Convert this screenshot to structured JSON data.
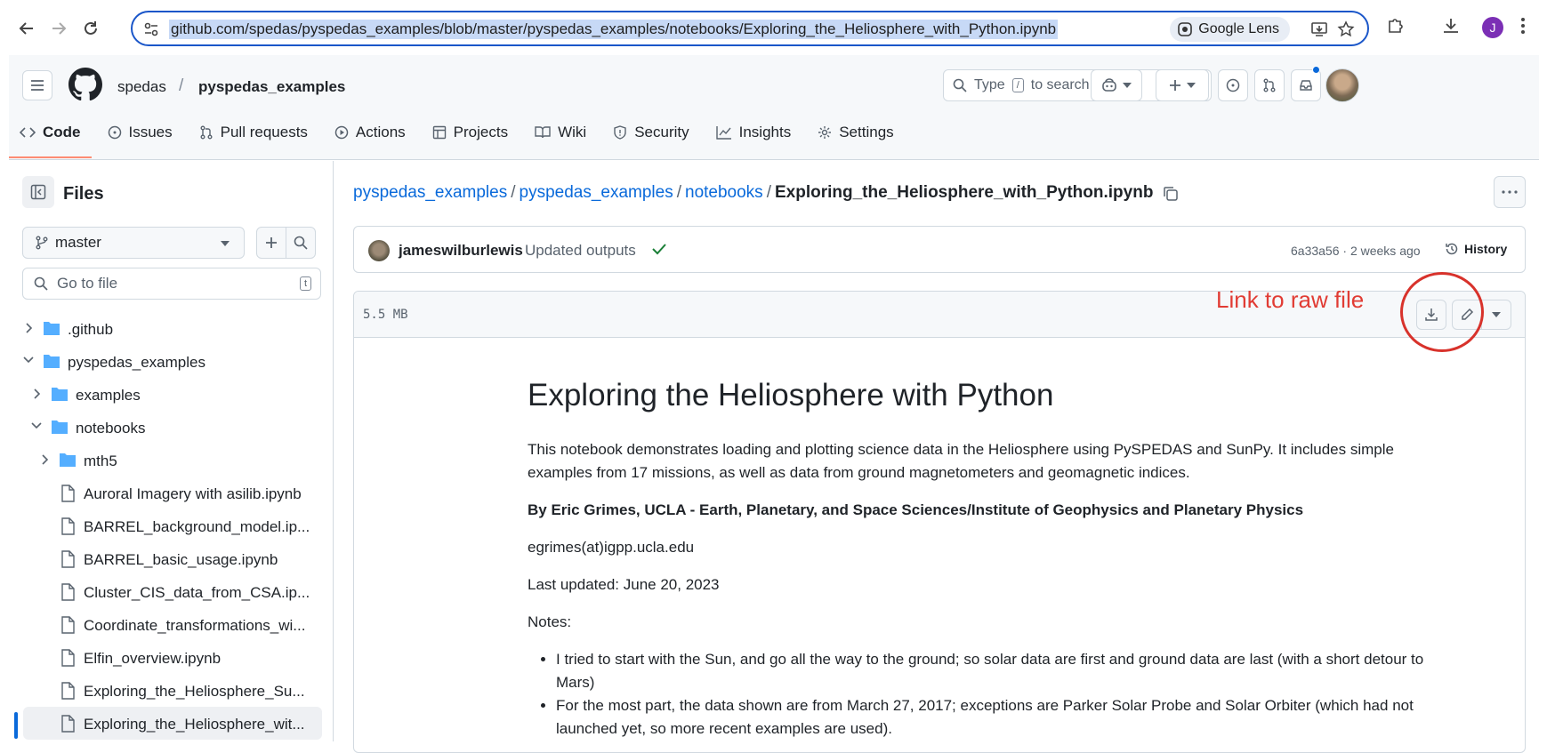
{
  "browser": {
    "url": "github.com/spedas/pyspedas_examples/blob/master/pyspedas_examples/notebooks/Exploring_the_Heliosphere_with_Python.ipynb",
    "lens_label": "Google Lens",
    "profile_initial": "J"
  },
  "header": {
    "owner": "spedas",
    "separator": "/",
    "repo": "pyspedas_examples",
    "search_prefix": "Type",
    "search_key": "/",
    "search_suffix": "to search"
  },
  "tabs": [
    {
      "label": "Code",
      "icon": "code-icon"
    },
    {
      "label": "Issues",
      "icon": "issue-icon"
    },
    {
      "label": "Pull requests",
      "icon": "pull-request-icon"
    },
    {
      "label": "Actions",
      "icon": "play-icon"
    },
    {
      "label": "Projects",
      "icon": "table-icon"
    },
    {
      "label": "Wiki",
      "icon": "book-icon"
    },
    {
      "label": "Security",
      "icon": "shield-icon"
    },
    {
      "label": "Insights",
      "icon": "graph-icon"
    },
    {
      "label": "Settings",
      "icon": "gear-icon"
    }
  ],
  "sidebar": {
    "title": "Files",
    "branch": "master",
    "goto_placeholder": "Go to file",
    "goto_key": "t",
    "tree": [
      {
        "label": ".github",
        "type": "folder",
        "expanded": false
      },
      {
        "label": "pyspedas_examples",
        "type": "folder",
        "expanded": true
      },
      {
        "label": "examples",
        "type": "folder",
        "expanded": false
      },
      {
        "label": "notebooks",
        "type": "folder",
        "expanded": true
      },
      {
        "label": "mth5",
        "type": "folder",
        "expanded": false
      },
      {
        "label": "Auroral Imagery with asilib.ipynb",
        "type": "file"
      },
      {
        "label": "BARREL_background_model.ip...",
        "type": "file"
      },
      {
        "label": "BARREL_basic_usage.ipynb",
        "type": "file"
      },
      {
        "label": "Cluster_CIS_data_from_CSA.ip...",
        "type": "file"
      },
      {
        "label": "Coordinate_transformations_wi...",
        "type": "file"
      },
      {
        "label": "Elfin_overview.ipynb",
        "type": "file"
      },
      {
        "label": "Exploring_the_Heliosphere_Su...",
        "type": "file"
      },
      {
        "label": "Exploring_the_Heliosphere_wit...",
        "type": "file",
        "selected": true
      }
    ]
  },
  "path": {
    "parts": [
      "pyspedas_examples",
      "pyspedas_examples",
      "notebooks"
    ],
    "separator": "/",
    "current": "Exploring_the_Heliosphere_with_Python.ipynb"
  },
  "commit": {
    "author": "jameswilburlewis",
    "message": "Updated outputs",
    "meta": "6a33a56 · 2 weeks ago",
    "history_label": "History"
  },
  "file": {
    "size": "5.5 MB"
  },
  "annotation": {
    "text": "Link to raw file",
    "color": "#e13c34"
  },
  "notebook": {
    "title": "Exploring the Heliosphere with Python",
    "intro": "This notebook demonstrates loading and plotting science data in the Heliosphere using PySPEDAS and SunPy. It includes simple examples from 17 missions, as well as data from ground magnetometers and geomagnetic indices.",
    "byline": "By Eric Grimes, UCLA - Earth, Planetary, and Space Sciences/Institute of Geophysics and Planetary Physics",
    "email": "egrimes(at)igpp.ucla.edu",
    "updated": "Last updated: June 20, 2023",
    "notes_label": "Notes:",
    "notes": [
      "I tried to start with the Sun, and go all the way to the ground; so solar data are first and ground data are last (with a short detour to Mars)",
      "For the most part, the data shown are from March 27, 2017; exceptions are Parker Solar Probe and Solar Orbiter (which had not launched yet, so more recent examples are used)."
    ]
  },
  "colors": {
    "link": "#0969da",
    "active_tab_underline": "#fd8c73",
    "success": "#1a7f37"
  }
}
